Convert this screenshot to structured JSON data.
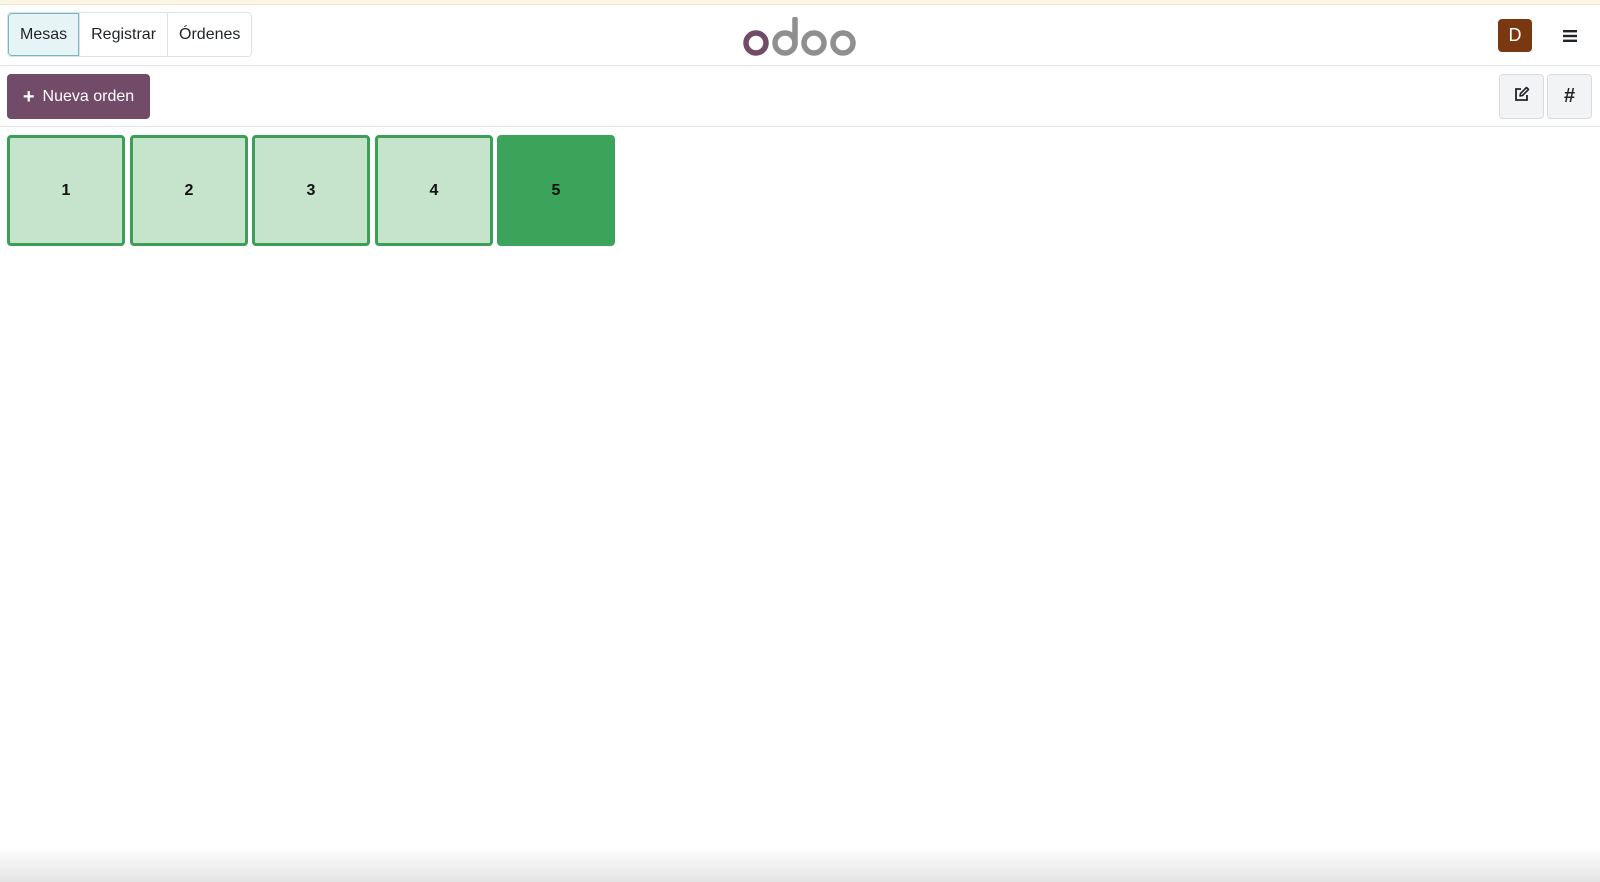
{
  "nav": {
    "tabs": [
      {
        "label": "Mesas",
        "active": true
      },
      {
        "label": "Registrar",
        "active": false
      },
      {
        "label": "Órdenes",
        "active": false
      }
    ],
    "logo_text": "odoo",
    "user_initial": "D"
  },
  "toolbar": {
    "new_order_label": "Nueva orden",
    "edit_icon": "edit-icon",
    "hash_icon": "#"
  },
  "tables": [
    {
      "number": "1",
      "status": "free"
    },
    {
      "number": "2",
      "status": "free"
    },
    {
      "number": "3",
      "status": "free"
    },
    {
      "number": "4",
      "status": "free"
    },
    {
      "number": "5",
      "status": "occupied"
    }
  ],
  "colors": {
    "brand": "#714b67",
    "table_border": "#3b9f57",
    "table_free": "#c6e3cc",
    "table_occupied": "#3ca35a",
    "avatar_bg": "#7a3811"
  }
}
